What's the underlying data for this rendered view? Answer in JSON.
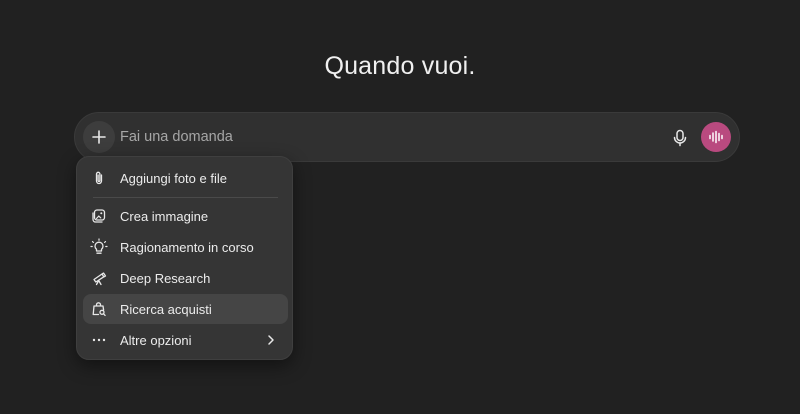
{
  "heading": "Quando vuoi.",
  "composer": {
    "placeholder": "Fai una domanda",
    "add_icon": "plus-icon",
    "mic_icon": "microphone-icon",
    "voice_icon": "voice-waveform-icon",
    "voice_button_color": "#b94a7f"
  },
  "menu": {
    "attach": {
      "label": "Aggiungi foto e file",
      "icon": "paperclip-icon"
    },
    "items": [
      {
        "label": "Crea immagine",
        "icon": "image-create-icon"
      },
      {
        "label": "Ragionamento in corso",
        "icon": "lightbulb-icon"
      },
      {
        "label": "Deep Research",
        "icon": "telescope-icon"
      },
      {
        "label": "Ricerca acquisti",
        "icon": "shopping-search-icon",
        "highlighted": true
      },
      {
        "label": "Altre opzioni",
        "icon": "more-dots-icon",
        "has_submenu": true
      }
    ]
  },
  "colors": {
    "background": "#212121",
    "composer": "#303030",
    "menu": "#353535",
    "menu_highlight": "#454545"
  }
}
